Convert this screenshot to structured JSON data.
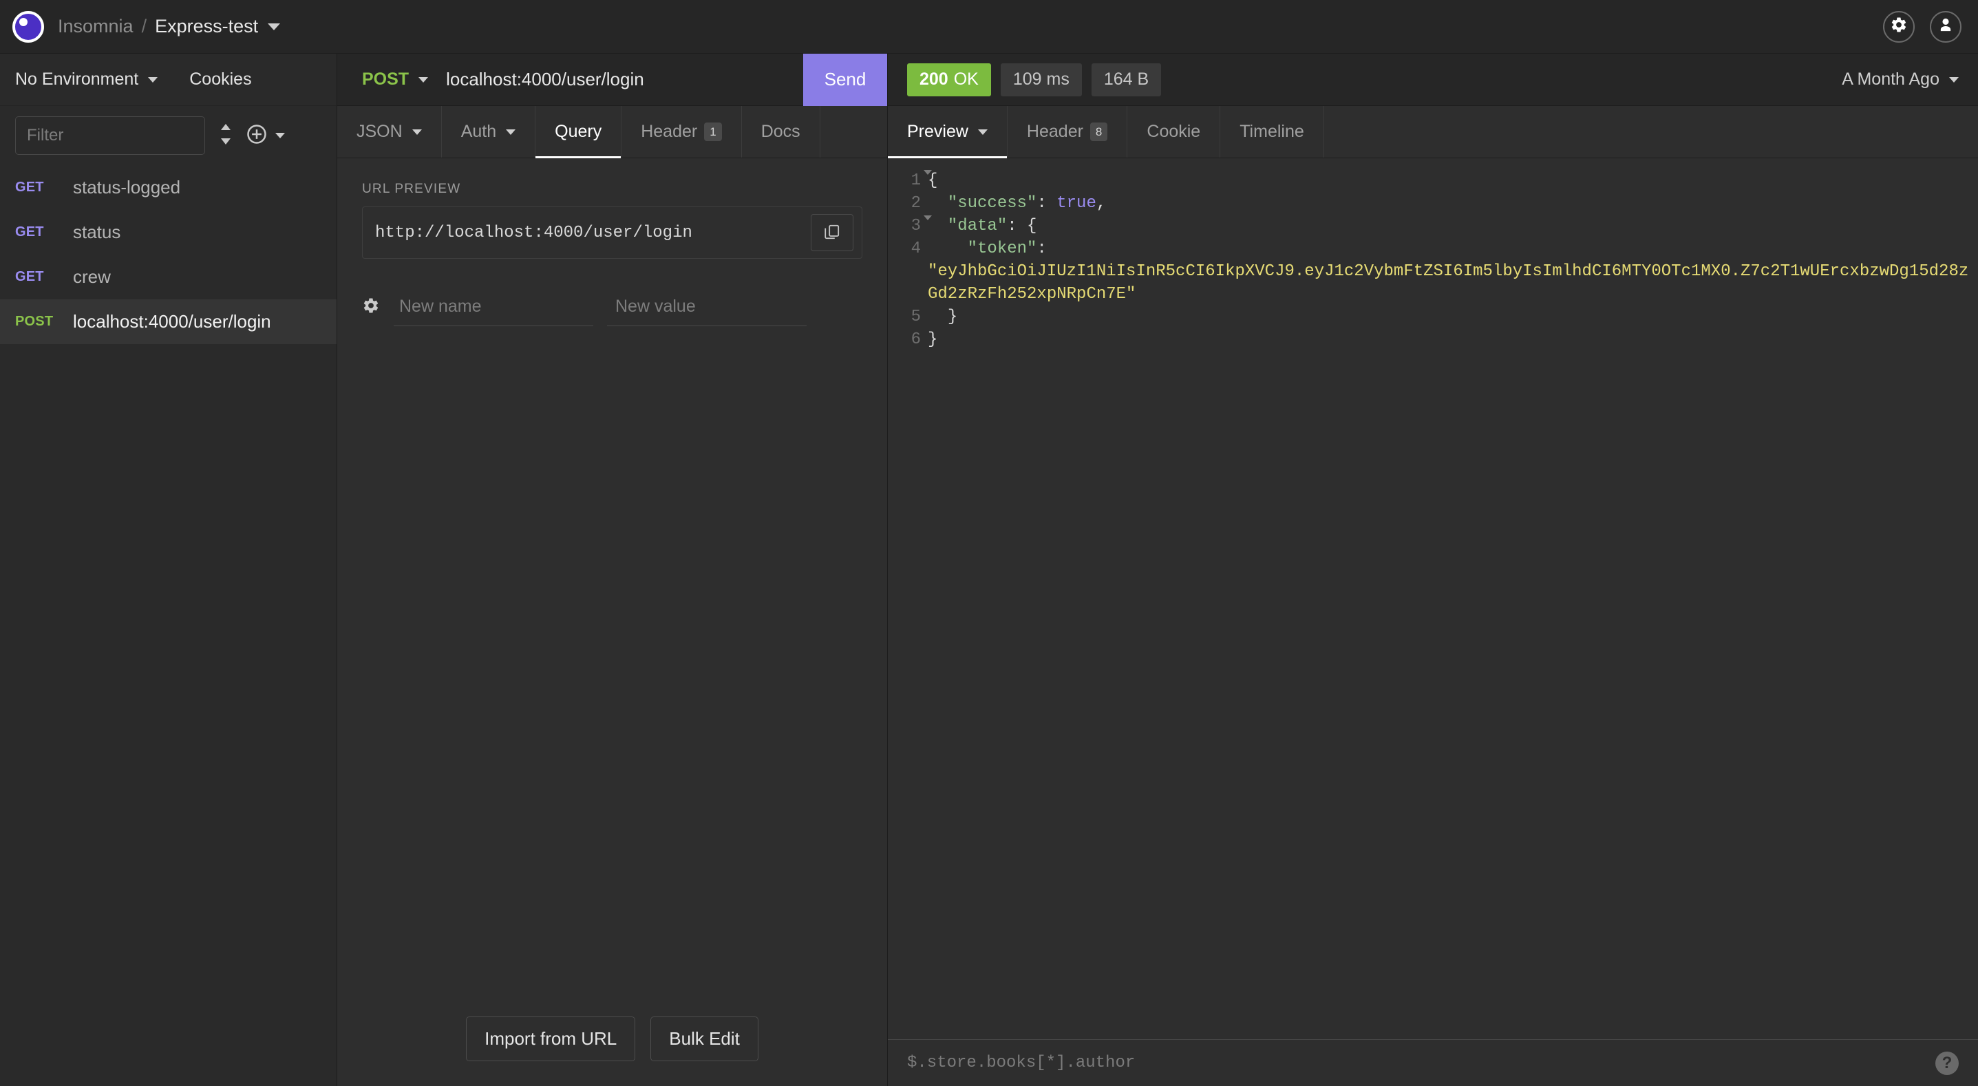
{
  "titlebar": {
    "app_name": "Insomnia",
    "separator": "/",
    "workspace": "Express-test",
    "settings_icon": "gear-icon",
    "account_icon": "user-avatar-icon"
  },
  "sidebar": {
    "environment": "No Environment",
    "cookies_label": "Cookies",
    "filter_placeholder": "Filter",
    "sort_icon": "sort-updown-icon",
    "add_icon": "plus-circle-icon",
    "requests": [
      {
        "method": "GET",
        "name": "status-logged",
        "active": false
      },
      {
        "method": "GET",
        "name": "status",
        "active": false
      },
      {
        "method": "GET",
        "name": "crew",
        "active": false
      },
      {
        "method": "POST",
        "name": "localhost:4000/user/login",
        "active": true
      }
    ]
  },
  "request": {
    "method": "POST",
    "url": "localhost:4000/user/login",
    "send_label": "Send",
    "tabs": [
      {
        "label": "JSON",
        "has_caret": true,
        "badge": null,
        "active": false
      },
      {
        "label": "Auth",
        "has_caret": true,
        "badge": null,
        "active": false
      },
      {
        "label": "Query",
        "has_caret": false,
        "badge": null,
        "active": true
      },
      {
        "label": "Header",
        "has_caret": false,
        "badge": "1",
        "active": false
      },
      {
        "label": "Docs",
        "has_caret": false,
        "badge": null,
        "active": false
      }
    ],
    "url_preview_label": "URL PREVIEW",
    "url_preview_value": "http://localhost:4000/user/login",
    "copy_icon": "copy-icon",
    "param_gear_icon": "gear-icon",
    "param_name_placeholder": "New name",
    "param_value_placeholder": "New value",
    "import_from_url_label": "Import from URL",
    "bulk_edit_label": "Bulk Edit"
  },
  "response": {
    "status_code": "200",
    "status_text": "OK",
    "time": "109 ms",
    "size": "164 B",
    "age": "A Month Ago",
    "tabs": [
      {
        "label": "Preview",
        "has_caret": true,
        "badge": null,
        "active": true
      },
      {
        "label": "Header",
        "has_caret": false,
        "badge": "8",
        "active": false
      },
      {
        "label": "Cookie",
        "has_caret": false,
        "badge": null,
        "active": false
      },
      {
        "label": "Timeline",
        "has_caret": false,
        "badge": null,
        "active": false
      }
    ],
    "line_numbers": [
      "1",
      "2",
      "3",
      "4",
      "5",
      "6"
    ],
    "body_token": "\"eyJhbGciOiJIUzI1NiIsInR5cCI6IkpXVCJ9.eyJ1c2VybmFtZSI6Im5lbyIsImlhdCI6MTY0OTc1MX0.Z7c2T1wUErcxbzwDg15d28zGd2zRzFh252xpNRpCn7E\"",
    "body_lines": {
      "l1": "{",
      "l2_key": "\"success\"",
      "l2_val": "true",
      "l3_key": "\"data\"",
      "l4_key": "\"token\"",
      "l5": "}",
      "l6": "}"
    },
    "jsonpath_placeholder": "$.store.books[*].author",
    "help_icon": "question-mark-icon"
  },
  "colors": {
    "accent_purple": "#8a7de6",
    "status_green": "#7cbb3f",
    "method_get": "#9a8cf0",
    "method_post": "#8bc34a",
    "string_yellow": "#e6db74",
    "bg": "#2e2e2e"
  }
}
